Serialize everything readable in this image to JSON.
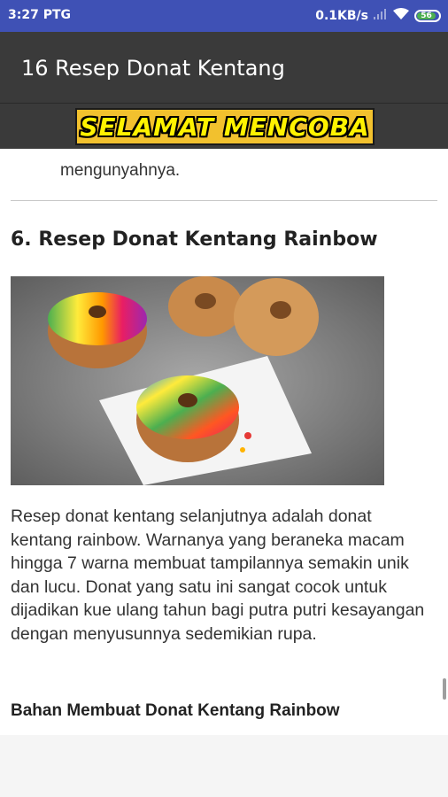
{
  "status": {
    "time": "3:27 PTG",
    "speed": "0.1KB/s",
    "battery": "56"
  },
  "appbar": {
    "title": "16 Resep Donat Kentang"
  },
  "banner": {
    "text": "SELAMAT MENCOBA"
  },
  "article": {
    "partial_line": "mengunyahnya.",
    "section_title": "6. Resep Donat Kentang Rainbow",
    "paragraph": "Resep donat kentang selanjutnya adalah donat kentang rainbow. Warnanya yang beraneka macam hingga 7 warna membuat tampilannya semakin unik dan lucu. Donat yang satu ini sangat cocok untuk dijadikan kue ulang tahun bagi putra putri kesayangan dengan menyusunnya sedemikian rupa.",
    "subheading": "Bahan Membuat Donat Kentang Rainbow"
  }
}
